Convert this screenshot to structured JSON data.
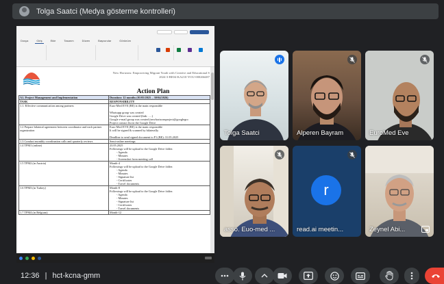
{
  "presenter_bar": {
    "title": "Tolga Saatci (Medya gösterme kontrolleri)",
    "icon": "presenter-avatar-icon"
  },
  "shared_screen": {
    "ribbon": {
      "tabs": [
        "Dosya",
        "Giriş",
        "Ekle",
        "Tasarım",
        "Düzen",
        "Başvurular",
        "Görünüm"
      ]
    },
    "document": {
      "header_line1": "New Horizons: Empowering Migrant Youth with Creative and Educational S",
      "header_line2": "2024-3-BE04-KA210-YOU-000266487",
      "title": "Action Plan",
      "table": {
        "header": [
          "A1. Project Management and Implementation",
          "Duration: 12 months (01/05/2025 – 30/04/2026)"
        ],
        "subheader": [
          "TASK",
          "RESPONSIBILITY"
        ],
        "rows": [
          {
            "task": "1.1. Effective communication among partners",
            "lines": [
              "Euro-Med EVE (BE) is the main responsible",
              "",
              "Whatsapp group was created",
              "Google Drive was created (link: ….)",
              "Google e-mail group was created (newhorizonsproject@googlegro",
              "Project contact list in the Google Drive"
            ]
          },
          {
            "task": "1.2 Prepare bilateral agreement between coordinator and each partner organization",
            "lines": [
              "Euro-Med EVE (BE) is the main responsible",
              "It will be signed & scanned by bilaterally.",
              "",
              "Deadline to send signed document to P1 (BE): 31.05.2025"
            ]
          },
          {
            "task": "1.3 Conduct monthly coordination calls and quarterly reviews",
            "lines": [
              "Semi-online meetings"
            ]
          },
          {
            "task": "1.4 TPM1 (online)",
            "lines": [
              "23.05.2025",
              "Followings will be upload to the Google Drive folder.",
              "- Agenda",
              "- Minutes",
              "- Screenshot from meeting call"
            ]
          },
          {
            "task": "1.5 TPM2 (in Austria)",
            "lines": [
              "Month-4",
              "Followings will be upload to the Google Drive folder.",
              "- Agenda",
              "- Minutes",
              "- Signature list",
              "- Certificates",
              "- Travel documents"
            ]
          },
          {
            "task": "1.6 TPM3 (in Turkey)",
            "lines": [
              "Month-8",
              "Followings will be upload to the Google Drive folder.",
              "- Agenda",
              "- Minutes",
              "- Signature list",
              "- Certificates",
              "- Travel documents"
            ]
          },
          {
            "task": "1.7 TPM4 (in Belgium)",
            "lines": [
              "Month-12"
            ]
          }
        ]
      }
    }
  },
  "participants": [
    {
      "name": "Tolga Saatci",
      "status": "speaking",
      "icon": "speaking-indicator-icon"
    },
    {
      "name": "Alperen Bayram",
      "status": "muted",
      "icon": "mic-off-icon"
    },
    {
      "name": "EuroMed Eve",
      "status": "muted",
      "icon": "mic-off-icon"
    },
    {
      "name": "asso. Euo-med ...",
      "status": "muted",
      "icon": "mic-off-icon"
    },
    {
      "name": "read.ai meetin...",
      "status": "muted",
      "icon": "mic-off-icon",
      "avatar_letter": "r"
    },
    {
      "name": "Zeynel Abi...",
      "status": "muted",
      "icon": "mic-off-icon"
    }
  ],
  "bottom_bar": {
    "time": "12:36",
    "separator": "|",
    "meeting_code": "hct-kcna-gmm"
  },
  "colors": {
    "background": "#202124",
    "control": "#3c4043",
    "end_call": "#ea4335",
    "accent": "#1a73e8"
  }
}
